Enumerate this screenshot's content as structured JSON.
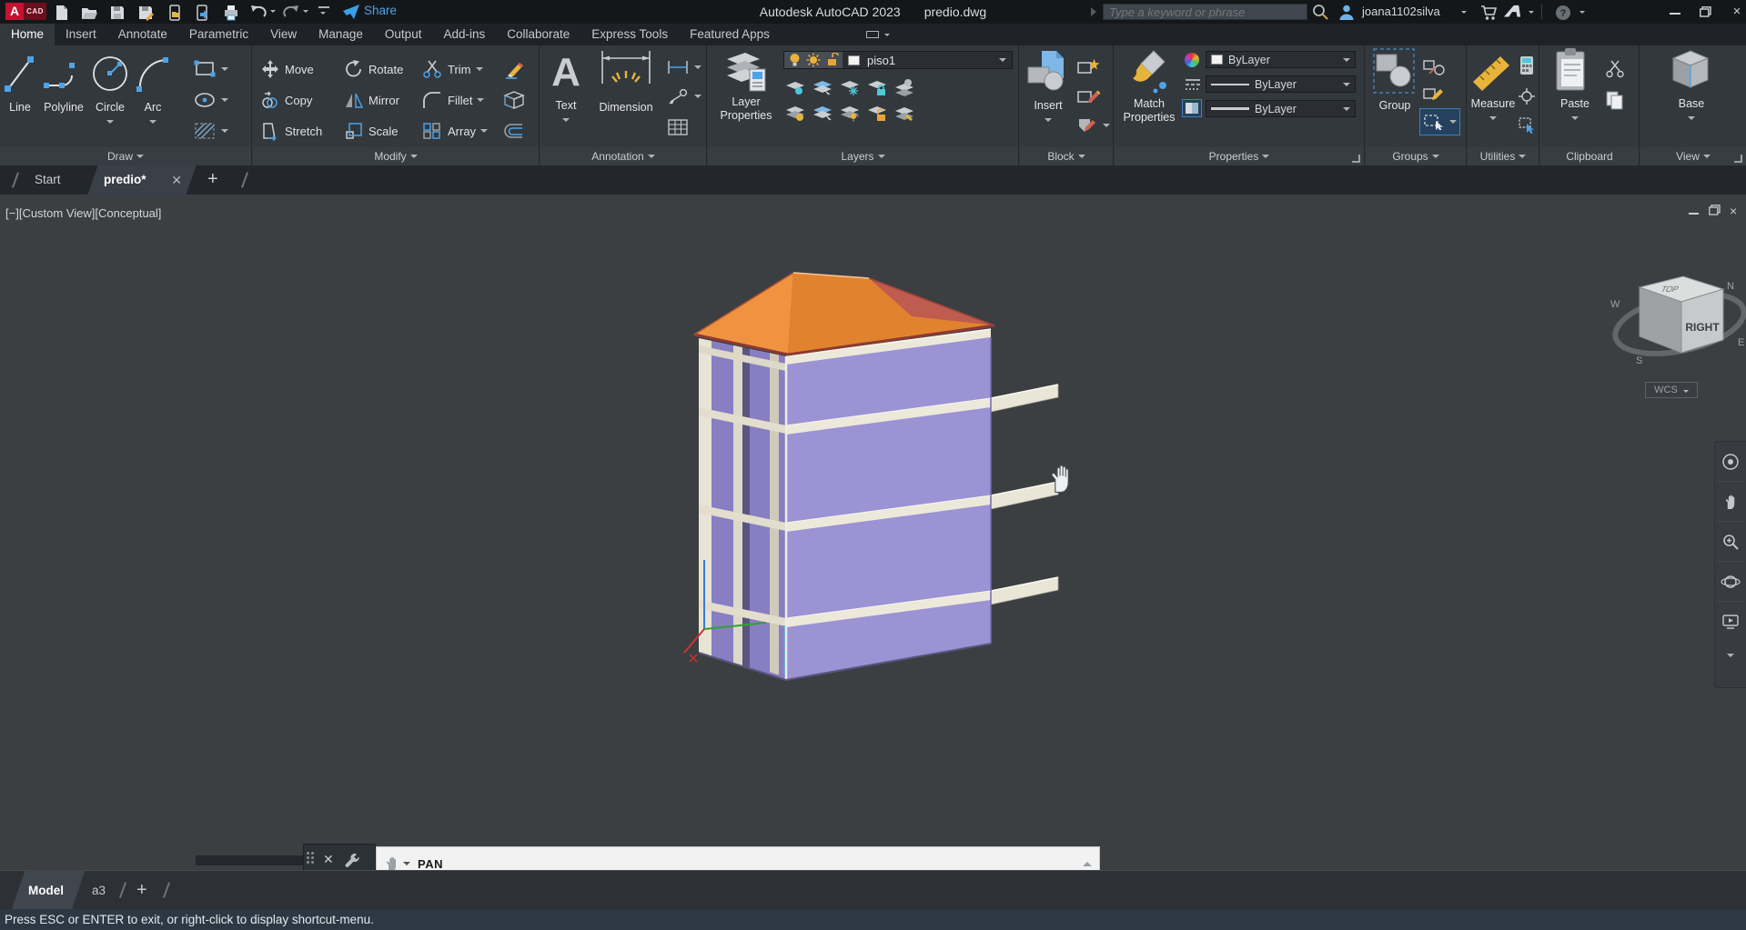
{
  "title_bar": {
    "logo_text": "CAD",
    "app_title": "Autodesk AutoCAD 2023",
    "doc_title": "predio.dwg",
    "share_label": "Share",
    "search_placeholder": "Type a keyword or phrase",
    "username": "joana1102silva"
  },
  "ribbon": {
    "tabs": [
      "Home",
      "Insert",
      "Annotate",
      "Parametric",
      "View",
      "Manage",
      "Output",
      "Add-ins",
      "Collaborate",
      "Express Tools",
      "Featured Apps"
    ],
    "panels": {
      "draw": {
        "label": "Draw",
        "line": "Line",
        "polyline": "Polyline",
        "circle": "Circle",
        "arc": "Arc"
      },
      "modify": {
        "label": "Modify",
        "move": "Move",
        "copy": "Copy",
        "stretch": "Stretch",
        "rotate": "Rotate",
        "mirror": "Mirror",
        "scale": "Scale",
        "trim": "Trim",
        "fillet": "Fillet",
        "array": "Array"
      },
      "annotation": {
        "label": "Annotation",
        "text": "Text",
        "dimension": "Dimension"
      },
      "layers": {
        "label": "Layers",
        "layer_properties_1": "Layer",
        "layer_properties_2": "Properties",
        "current_layer": "piso1"
      },
      "block": {
        "label": "Block",
        "insert": "Insert"
      },
      "properties": {
        "label": "Properties",
        "match_1": "Match",
        "match_2": "Properties",
        "color": "ByLayer",
        "linetype": "ByLayer",
        "lineweight": "ByLayer"
      },
      "groups": {
        "label": "Groups",
        "group": "Group"
      },
      "utilities": {
        "label": "Utilities",
        "measure": "Measure"
      },
      "clipboard": {
        "label": "Clipboard",
        "paste": "Paste"
      },
      "view": {
        "label": "View",
        "base": "Base"
      }
    }
  },
  "file_tabs": {
    "start": "Start",
    "document": "predio*"
  },
  "viewport": {
    "minimize": "[−]",
    "view_control": "[Custom View]",
    "visual_style": "[Conceptual]",
    "viewcube_front": "RIGHT",
    "viewcube_top": "TOP",
    "compass_n": "N",
    "compass_e": "E",
    "compass_s": "S",
    "compass_w": "W",
    "wcs": "WCS"
  },
  "command_line": {
    "command": "PAN"
  },
  "layout_tabs": {
    "model": "Model",
    "layout1": "a3"
  },
  "status_bar": {
    "hint": "Press ESC or ENTER to exit, or right-click to display shortcut-menu."
  },
  "colors": {
    "accent_blue": "#4da3e8",
    "roof_orange": "#ef9340",
    "wall_purple": "#9b93d4",
    "slab_cream": "#ece8da",
    "highlight_yellow": "#e8b33a"
  }
}
